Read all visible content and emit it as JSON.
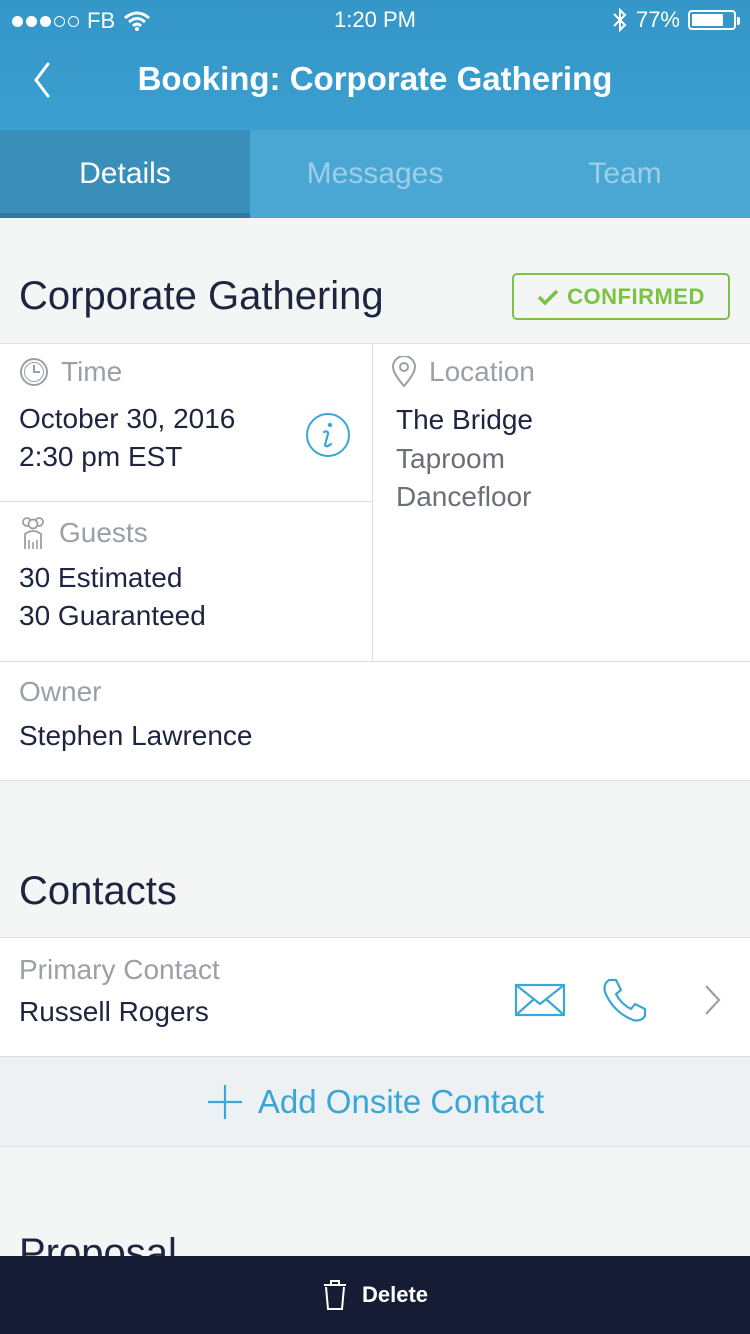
{
  "status_bar": {
    "carrier": "FB",
    "time": "1:20 PM",
    "battery": "77%",
    "battery_level": 0.77
  },
  "nav": {
    "title": "Booking: Corporate Gathering"
  },
  "tabs": [
    {
      "label": "Details",
      "active": true
    },
    {
      "label": "Messages",
      "active": false
    },
    {
      "label": "Team",
      "active": false
    }
  ],
  "booking": {
    "title": "Corporate Gathering",
    "status": "CONFIRMED"
  },
  "details": {
    "time": {
      "label": "Time",
      "date": "October 30, 2016",
      "time": "2:30 pm EST"
    },
    "location": {
      "label": "Location",
      "venue": "The Bridge",
      "rooms": [
        "Taproom",
        "Dancefloor"
      ]
    },
    "guests": {
      "label": "Guests",
      "estimated": "30 Estimated",
      "guaranteed": "30 Guaranteed"
    },
    "owner": {
      "label": "Owner",
      "name": "Stephen Lawrence"
    }
  },
  "contacts": {
    "title": "Contacts",
    "primary_label": "Primary Contact",
    "primary_name": "Russell Rogers",
    "add_label": "Add Onsite Contact"
  },
  "proposal": {
    "title": "Proposal"
  },
  "bottom_bar": {
    "delete_label": "Delete"
  },
  "colors": {
    "header": "#3596c8",
    "accent": "#3aa6d6",
    "confirmed": "#7cc242",
    "bottom_bar": "#161c33"
  }
}
